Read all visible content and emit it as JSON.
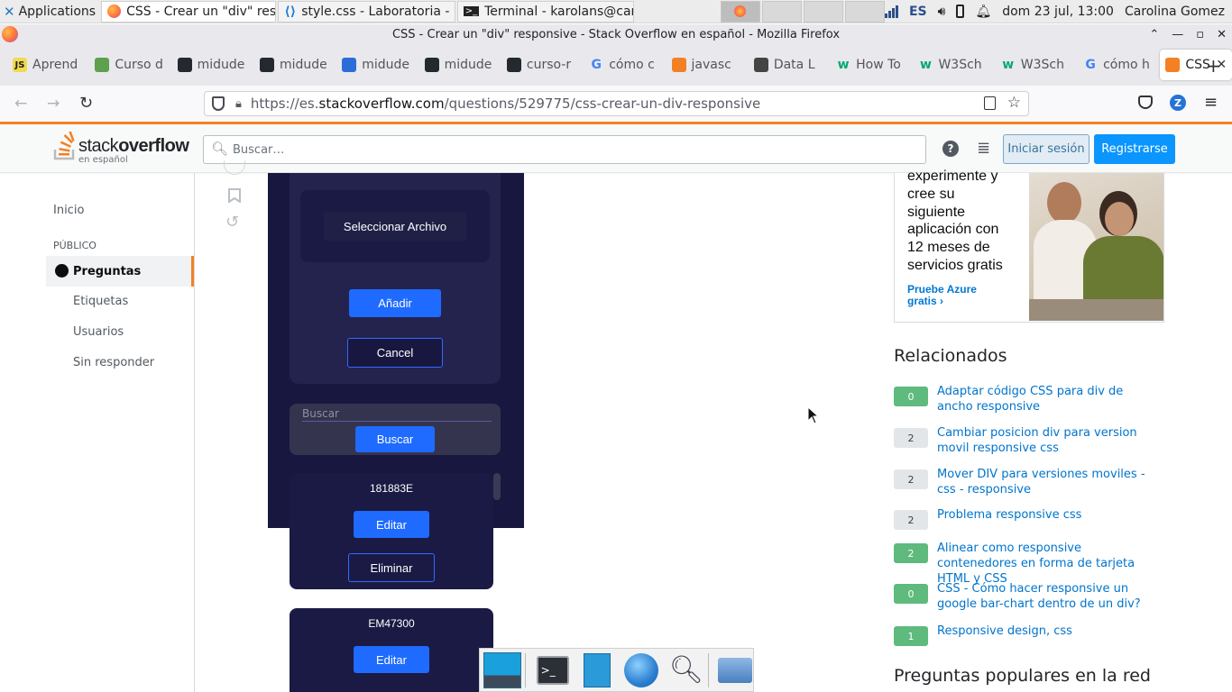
{
  "panel": {
    "apps_label": "Applications",
    "tasks": [
      {
        "label": "CSS - Crear un \"div\" res…",
        "icon": "firefox-icon"
      },
      {
        "label": "style.css - Laboratoria - …",
        "icon": "vscode-icon"
      },
      {
        "label": "Terminal - karolans@car…",
        "icon": "terminal-icon"
      }
    ],
    "lang": "ES",
    "datetime": "dom 23 jul, 13:00",
    "user": "Carolina Gomez"
  },
  "window": {
    "title": "CSS - Crear un \"div\" responsive - Stack Overflow en español - Mozilla Firefox"
  },
  "tabs": [
    {
      "label": "Aprend",
      "icon_text": "JS",
      "color": "#f0db4f"
    },
    {
      "label": "Curso d",
      "icon_text": "",
      "color": "#5fa04e"
    },
    {
      "label": "midude",
      "icon_text": "",
      "color": "#24292f"
    },
    {
      "label": "midude",
      "icon_text": "",
      "color": "#24292f"
    },
    {
      "label": "midude",
      "icon_text": "",
      "color": "#2b6dd8"
    },
    {
      "label": "midude",
      "icon_text": "",
      "color": "#24292f"
    },
    {
      "label": "curso-r",
      "icon_text": "",
      "color": "#24292f"
    },
    {
      "label": "cómo c",
      "icon_text": "G",
      "color": "#4285f4"
    },
    {
      "label": "javasc",
      "icon_text": "",
      "color": "#f48024"
    },
    {
      "label": "Data L",
      "icon_text": "",
      "color": "#444444"
    },
    {
      "label": "How To",
      "icon_text": "w",
      "color": "#04aa6d"
    },
    {
      "label": "W3Sch",
      "icon_text": "w",
      "color": "#04aa6d"
    },
    {
      "label": "W3Sch",
      "icon_text": "w",
      "color": "#04aa6d"
    },
    {
      "label": "cómo h",
      "icon_text": "G",
      "color": "#4285f4"
    },
    {
      "label": "CSS",
      "icon_text": "",
      "color": "#f48024"
    }
  ],
  "url": {
    "prefix": "https://es.",
    "domain": "stackoverflow.com",
    "path": "/questions/529775/css-crear-un-div-responsive"
  },
  "so": {
    "logo_main_a": "stack",
    "logo_main_b": "overflow",
    "logo_sub": "en español",
    "search_placeholder": "Buscar…",
    "login": "Iniciar sesión",
    "signup": "Registrarse"
  },
  "leftnav": {
    "home": "Inicio",
    "public": "PÚBLICO",
    "questions": "Preguntas",
    "tags": "Etiquetas",
    "users": "Usuarios",
    "unanswered": "Sin responder"
  },
  "embedded": {
    "select_file": "Seleccionar Archivo",
    "add": "Añadir",
    "cancel": "Cancel",
    "search_placeholder": "Buscar",
    "search_btn": "Buscar",
    "card1_code": "181883E",
    "edit": "Editar",
    "delete": "Eliminar",
    "card2_code": "EM47300"
  },
  "ad": {
    "text": [
      "experimente y",
      "cree su",
      "siguiente",
      "aplicación con",
      "12 meses de",
      "servicios gratis"
    ],
    "link": [
      "Pruebe Azure",
      "gratis ›"
    ]
  },
  "related": {
    "title": "Relacionados",
    "items": [
      {
        "score": "0",
        "title": "Adaptar código CSS para div de ancho responsive",
        "accepted": true
      },
      {
        "score": "2",
        "title": "Cambiar posicion div para version movil responsive css",
        "accepted": false
      },
      {
        "score": "2",
        "title": "Mover DIV para versiones moviles - css - responsive",
        "accepted": false
      },
      {
        "score": "2",
        "title": "Problema responsive css",
        "accepted": false
      },
      {
        "score": "2",
        "title": "Alinear como responsive contenedores en forma de tarjeta HTML y CSS",
        "accepted": true
      },
      {
        "score": "0",
        "title": "CSS - Cómo hacer responsive un google bar-chart dentro de un div?",
        "accepted": true
      },
      {
        "score": "1",
        "title": "Responsive design, css",
        "accepted": true
      }
    ],
    "hot_title": "Preguntas populares en la red"
  }
}
